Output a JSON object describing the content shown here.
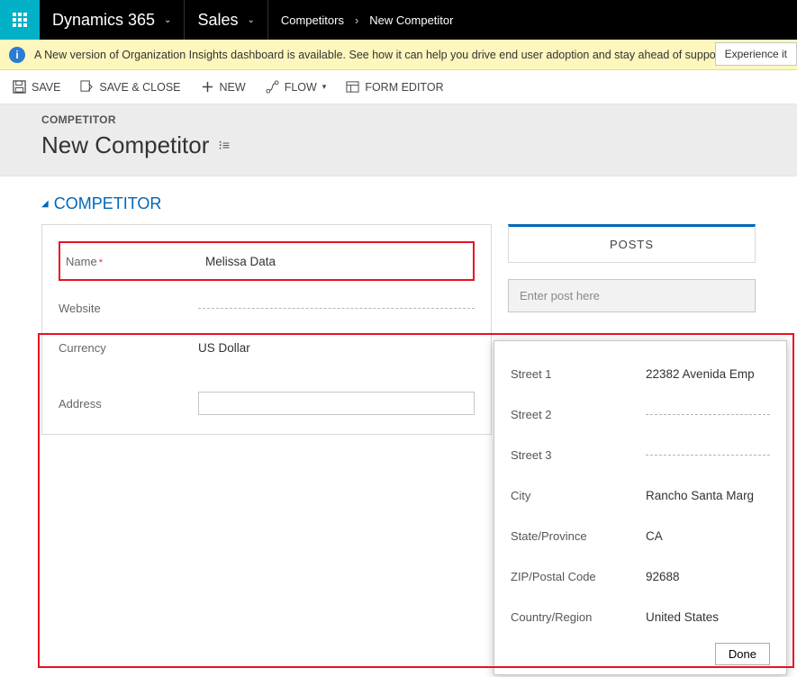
{
  "topbar": {
    "product": "Dynamics 365",
    "module": "Sales",
    "breadcrumb_parent": "Competitors",
    "breadcrumb_current": "New Competitor"
  },
  "notification": {
    "text": "A New version of Organization Insights dashboard is available. See how it can help you drive end user adoption and stay ahead of support issues.",
    "experience_label": "Experience it"
  },
  "commands": {
    "save": "SAVE",
    "save_close": "SAVE & CLOSE",
    "new": "NEW",
    "flow": "FLOW",
    "form_editor": "FORM EDITOR"
  },
  "header": {
    "entity_label": "COMPETITOR",
    "page_title": "New Competitor"
  },
  "section": {
    "title": "COMPETITOR"
  },
  "form": {
    "name_label": "Name",
    "name_value": "Melissa Data",
    "website_label": "Website",
    "currency_label": "Currency",
    "currency_value": "US Dollar",
    "address_label": "Address"
  },
  "posts": {
    "tab_label": "POSTS",
    "placeholder": "Enter post here"
  },
  "address_flyout": {
    "street1_label": "Street 1",
    "street1_value": "22382 Avenida Emp",
    "street2_label": "Street 2",
    "street3_label": "Street 3",
    "city_label": "City",
    "city_value": "Rancho Santa Marg",
    "state_label": "State/Province",
    "state_value": "CA",
    "zip_label": "ZIP/Postal Code",
    "zip_value": "92688",
    "country_label": "Country/Region",
    "country_value": "United States",
    "done_label": "Done"
  }
}
